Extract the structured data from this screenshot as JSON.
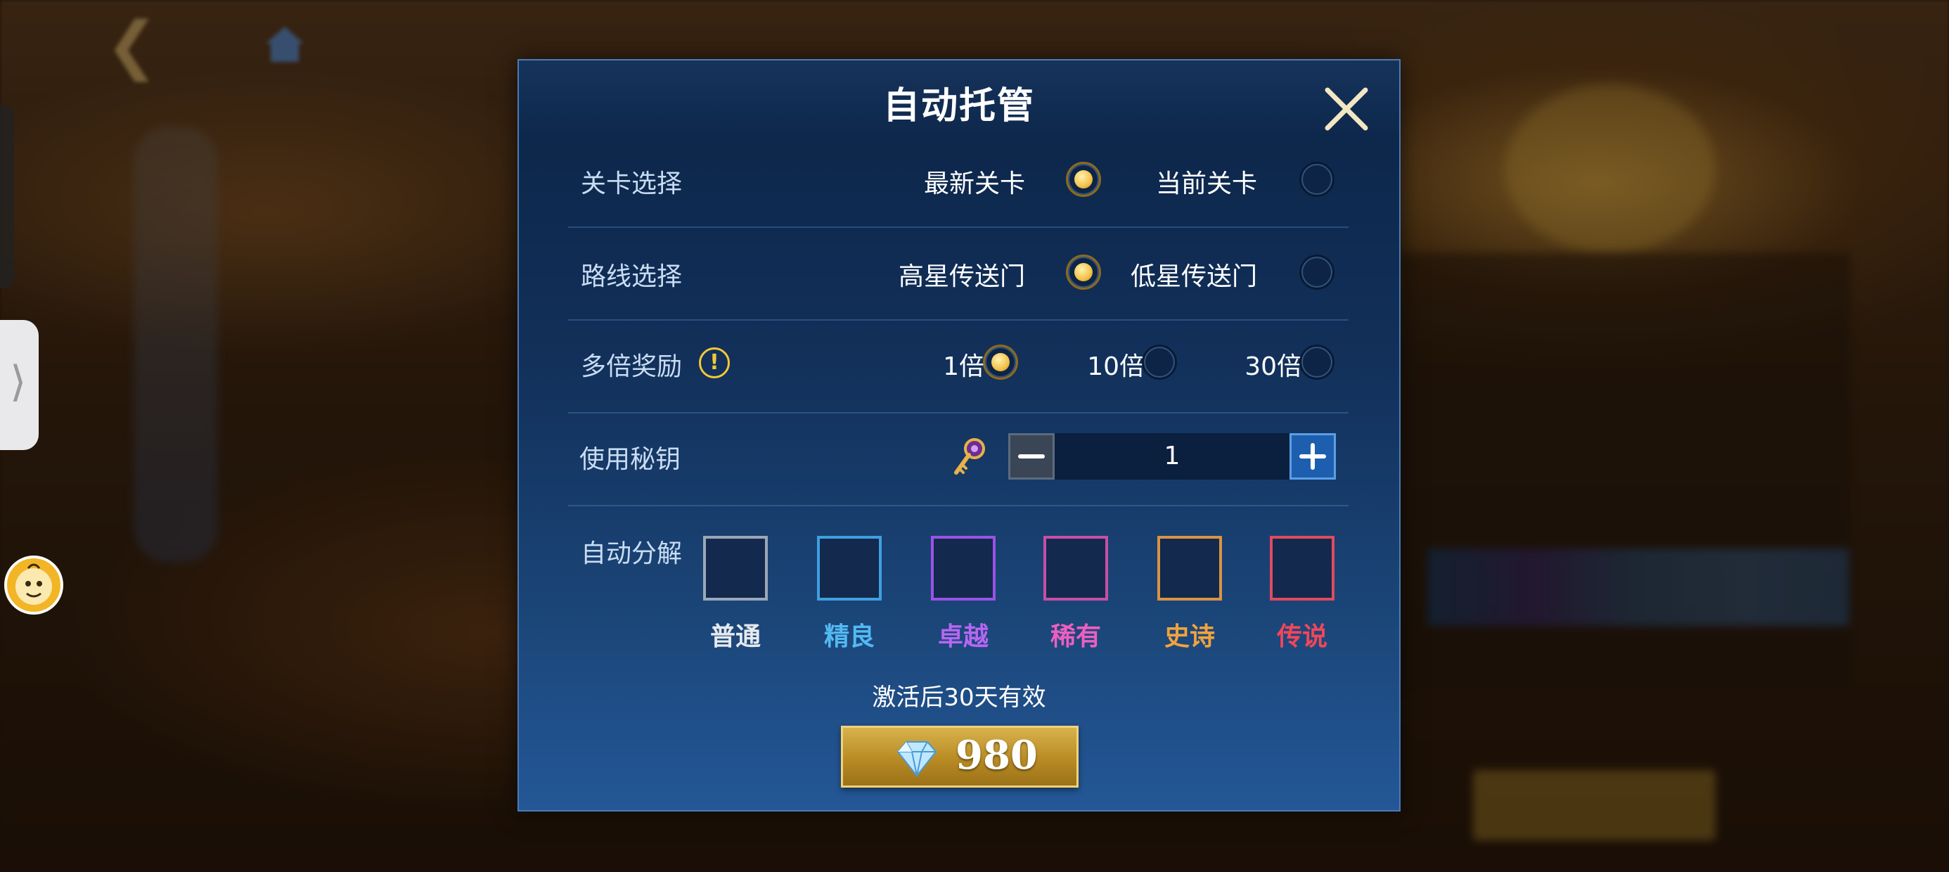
{
  "dialog": {
    "title": "自动托管",
    "rows": {
      "stage": {
        "label": "关卡选择",
        "options": [
          {
            "label": "最新关卡",
            "selected": true
          },
          {
            "label": "当前关卡",
            "selected": false
          }
        ]
      },
      "route": {
        "label": "路线选择",
        "options": [
          {
            "label": "高星传送门",
            "selected": true
          },
          {
            "label": "低星传送门",
            "selected": false
          }
        ]
      },
      "multiplier": {
        "label": "多倍奖励",
        "info_icon": "!",
        "options": [
          {
            "label": "1倍",
            "selected": true
          },
          {
            "label": "10倍",
            "selected": false
          },
          {
            "label": "30倍",
            "selected": false
          }
        ]
      },
      "key": {
        "label": "使用秘钥",
        "icon": "key-icon",
        "value": "1"
      },
      "decompose": {
        "label": "自动分解",
        "qualities": [
          {
            "label": "普通",
            "color": "#e6e9ee",
            "border": "#9aa7b8"
          },
          {
            "label": "精良",
            "color": "#53b9f2",
            "border": "#3f9fe0"
          },
          {
            "label": "卓越",
            "color": "#b766f2",
            "border": "#9a52e6"
          },
          {
            "label": "稀有",
            "color": "#ee5ec0",
            "border": "#c64fa6"
          },
          {
            "label": "史诗",
            "color": "#f2a33c",
            "border": "#d99443"
          },
          {
            "label": "传说",
            "color": "#f2465a",
            "border": "#e04a5f"
          }
        ]
      }
    },
    "note": "激活后30天有效",
    "buy": {
      "icon": "diamond-icon",
      "price": "980"
    }
  }
}
